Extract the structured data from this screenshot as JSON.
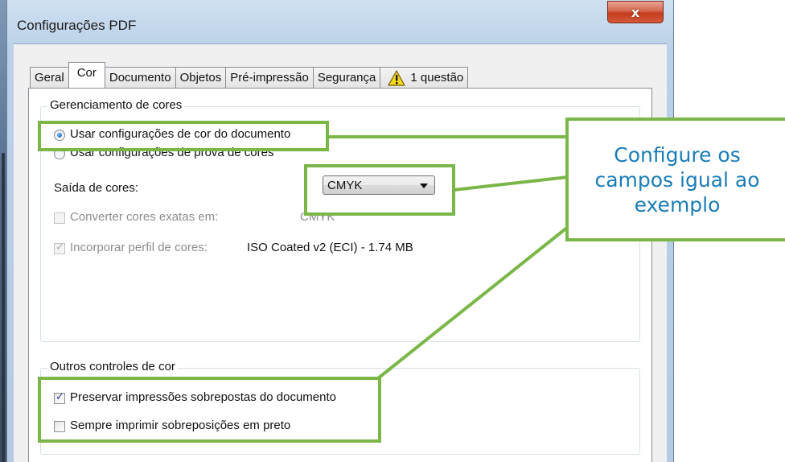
{
  "window": {
    "title": "Configurações PDF",
    "close_glyph": "x"
  },
  "tabs": [
    {
      "label": "Geral",
      "active": false
    },
    {
      "label": "Cor",
      "active": true
    },
    {
      "label": "Documento",
      "active": false
    },
    {
      "label": "Objetos",
      "active": false
    },
    {
      "label": "Pré-impressão",
      "active": false
    },
    {
      "label": "Segurança",
      "active": false
    },
    {
      "label": "1 questão",
      "active": false,
      "icon": "warning-icon"
    }
  ],
  "color_management": {
    "group_label": "Gerenciamento de cores",
    "radio_document": {
      "label": "Usar configurações de cor do documento",
      "checked": true
    },
    "radio_proof": {
      "label": "Usar configurações de prova de cores",
      "checked": false
    },
    "output_label": "Saída de cores:",
    "output_value": "CMYK",
    "convert_spot": {
      "label": "Converter cores exatas em:",
      "value": "CMYK",
      "checked": false,
      "disabled": true
    },
    "embed_profile": {
      "label": "Incorporar perfil de cores:",
      "value": "ISO Coated v2 (ECI) - 1.74 MB",
      "checked": true,
      "disabled": true
    }
  },
  "other_color": {
    "group_label": "Outros controles de cor",
    "preserve_overprint": {
      "label": "Preservar impressões sobrepostas do documento",
      "checked": true
    },
    "always_black_overprint": {
      "label": "Sempre imprimir sobreposições em preto",
      "checked": false
    }
  },
  "annotation": {
    "callout_text": "Configure os campos igual ao exemplo",
    "highlight_color": "#7ab648",
    "text_color": "#1a7db8"
  }
}
